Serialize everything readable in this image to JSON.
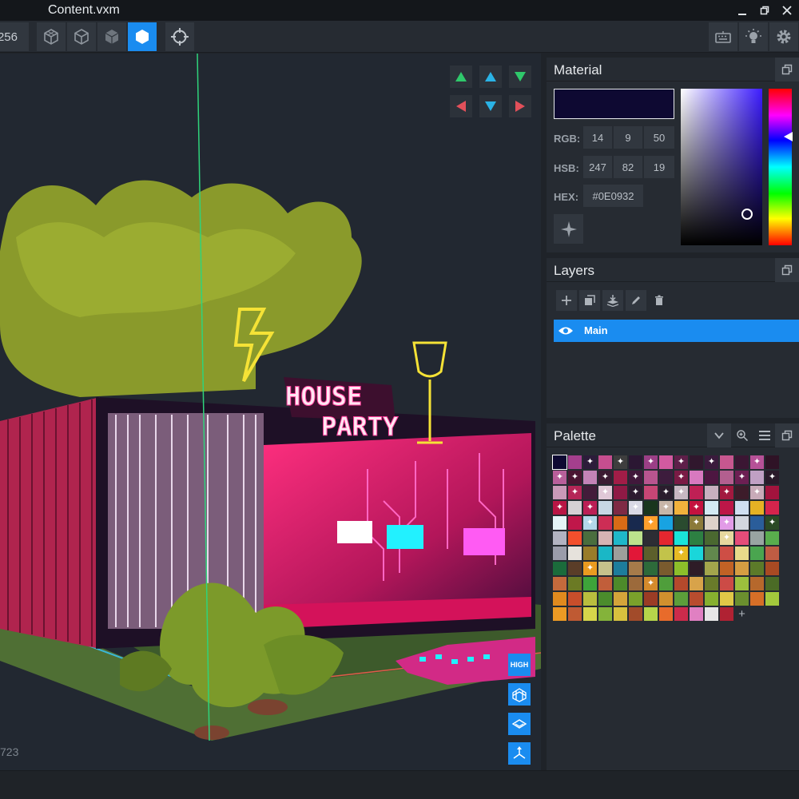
{
  "window": {
    "title": "Content.vxm"
  },
  "toolbar": {
    "size_value": "256"
  },
  "viewport": {
    "frame_counter": "723",
    "sign_line1": "HOUSE",
    "sign_line2": "PARTY"
  },
  "view_buttons": {
    "quality_label": "HIGH"
  },
  "material": {
    "title": "Material",
    "color": "#0E0932",
    "rgb_label": "RGB:",
    "rgb": [
      "14",
      "9",
      "50"
    ],
    "hsb_label": "HSB:",
    "hsb": [
      "247",
      "82",
      "19"
    ],
    "hex_label": "HEX:",
    "hex": "#0E0932"
  },
  "layers": {
    "title": "Layers",
    "items": [
      {
        "name": "Main",
        "visible": true
      }
    ]
  },
  "palette": {
    "title": "Palette",
    "marked_swatches": [
      2,
      4,
      6,
      8,
      10,
      13,
      15,
      16,
      18,
      20,
      23,
      27,
      29,
      31,
      33,
      35,
      37,
      38,
      41,
      43,
      45,
      47,
      50,
      52,
      54,
      62,
      66,
      69,
      71,
      74,
      86,
      98,
      107,
      126
    ]
  },
  "colors": {
    "accent": "#1A8CF0",
    "panel": "#262B32",
    "palette_rows": [
      [
        "#0e0932",
        "#a43f8d",
        "#2c1c3a",
        "#c64e8f",
        "#3e3e3e",
        "#2b1733",
        "#9b3f86",
        "#d25aa0",
        "#5e1f49",
        "#30172d",
        "#3a1b3c",
        "#c7578f",
        "#3b1633",
        "#b65197",
        "#2f1326"
      ],
      [
        "#b85f9a",
        "#4a1532",
        "#c383b7",
        "#3b1b33",
        "#a11d47",
        "#41183b",
        "#b7558f",
        "#3d1c3d",
        "#7a1b45",
        "#d879c0",
        "#4d1641",
        "#b35f8f",
        "#6d1f53",
        "#c0a0c4",
        "#2a1a2a"
      ],
      [
        "#c99ab8",
        "#b52657",
        "#431c3a",
        "#e0c8d7",
        "#8f1a45",
        "#2d1b30",
        "#c64675",
        "#2a1d2d",
        "#c7b8c2",
        "#bf2055",
        "#c7b0c0",
        "#a2193f",
        "#3d1c2a",
        "#c8aab8",
        "#a3133d"
      ],
      [
        "#b91645",
        "#d5d1d5",
        "#bb1f55",
        "#c7d7e4",
        "#7e2a44",
        "#d9d9e5",
        "#18351d",
        "#c8b6a8",
        "#f1b23c",
        "#c4123f",
        "#d3eaf3",
        "#bd1648",
        "#d0dff1",
        "#e5b124",
        "#d6244c"
      ],
      [
        "#e5f4f8",
        "#c0174a",
        "#b3d8ea",
        "#cd2d55",
        "#d86b16",
        "#18294e",
        "#fd9f2c",
        "#18a3e2",
        "#2a4b2f",
        "#8b7a39",
        "#ddd2c9",
        "#e29be7",
        "#d3d6de",
        "#2a5d9a",
        "#2b4a25"
      ],
      [
        "#b2b3c1",
        "#f24f2c",
        "#4a6e3e",
        "#d6b3b3",
        "#1fb7c9",
        "#bde38c",
        "#2d2d34",
        "#e4272f",
        "#1ae3da",
        "#2d7f42",
        "#4a6830",
        "#e6d89e",
        "#e54c79",
        "#99a4a2",
        "#59ad4d"
      ],
      [
        "#9a9caa",
        "#e6e2dc",
        "#997c2a",
        "#1ab7c6",
        "#9d9e9b",
        "#e21738",
        "#5c5f2b",
        "#c2c34a",
        "#e7ba23",
        "#1ad6da",
        "#62884d",
        "#ce4e45",
        "#e8da8a",
        "#4aa54f",
        "#bf5c43"
      ],
      [
        "#1b6b3b",
        "#5a3d28",
        "#ea9b20",
        "#c6c18b",
        "#1d7d9c",
        "#a67b4a",
        "#2d6a3a",
        "#7a5b2e",
        "#8cbf2a",
        "#2e1c27",
        "#a3a54c",
        "#c16225",
        "#d59d42",
        "#5c7a29",
        "#a94a23"
      ],
      [
        "#c46a3c",
        "#6b7a24",
        "#3ea43a",
        "#c15e3a",
        "#4d8a2a",
        "#9c6a3b",
        "#d48a2b",
        "#4f9e3b",
        "#b5492c",
        "#d8a34a",
        "#697b2a",
        "#cc4b46",
        "#9cbf3d",
        "#b6682c",
        "#4b6b26"
      ],
      [
        "#e08a1e",
        "#c84e2b",
        "#b9bd3e",
        "#4b8c2c",
        "#d4a43a",
        "#7aa12b",
        "#9b3c25",
        "#d0902e",
        "#5c9e3a",
        "#b94c2e",
        "#86b02f",
        "#e0c847",
        "#6b8f2e",
        "#d66f27",
        "#a3c93c"
      ],
      [
        "#ec9a24",
        "#bf5a33",
        "#d6d64a",
        "#84b33a",
        "#d7c13e",
        "#a24b2a",
        "#b6d54a",
        "#e86b2b",
        "#cc2b4b",
        "#e080c2",
        "#e6e6e6",
        "#b02233",
        "#000000",
        "#000000",
        "#000000"
      ]
    ]
  }
}
